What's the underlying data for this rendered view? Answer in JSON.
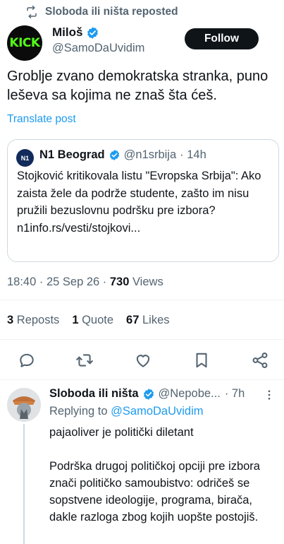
{
  "repost": {
    "label": "Sloboda ili ništa reposted",
    "icon": "repost-icon"
  },
  "post": {
    "avatar_text": "KICK",
    "display_name": "Miloš",
    "handle": "@SamoDaUvidim",
    "follow_label": "Follow",
    "text": "Groblje zvano demokratska stranka, puno leševa sa kojima ne znaš šta ćeš.",
    "translate_label": "Translate post",
    "timestamp": "18:40 · 25 Sep 26 · ",
    "views_count": "730",
    "views_label": " Views"
  },
  "quote": {
    "avatar_text": "N1",
    "name": "N1 Beograd",
    "handle": "@n1srbija",
    "time": "· 14h",
    "text": "Stojković kritikovala listu \"Evropska Srbija\": Ako zaista žele da podrže studente, zašto im nisu pružili bezuslovnu podršku pre izbora?",
    "link": "n1info.rs/vesti/stojkovi..."
  },
  "stats": {
    "reposts_count": "3",
    "reposts_label": "Reposts",
    "quotes_count": "1",
    "quotes_label": "Quote",
    "likes_count": "67",
    "likes_label": "Likes"
  },
  "actions": [
    "reply-icon",
    "repost-icon",
    "like-icon",
    "bookmark-icon",
    "share-icon"
  ],
  "reply": {
    "name": "Sloboda ili ništa",
    "handle": "@Nepobe...",
    "time": "· 7h",
    "replying_prefix": "Replying to ",
    "replying_to": "@SamoDaUvidim",
    "text": "pajaoliver je politički diletant\n\nPodrška drugoj političkoj opciji pre izbora znači političko samoubistvo: odričeš se sopstvene ideologije, programa, birača, dakle razloga zbog kojih uopšte postojiš."
  },
  "colors": {
    "accent": "#1d9bf0",
    "secondary_text": "#536471",
    "verified": "#1d9bf0",
    "kick_green": "#53fc18"
  }
}
